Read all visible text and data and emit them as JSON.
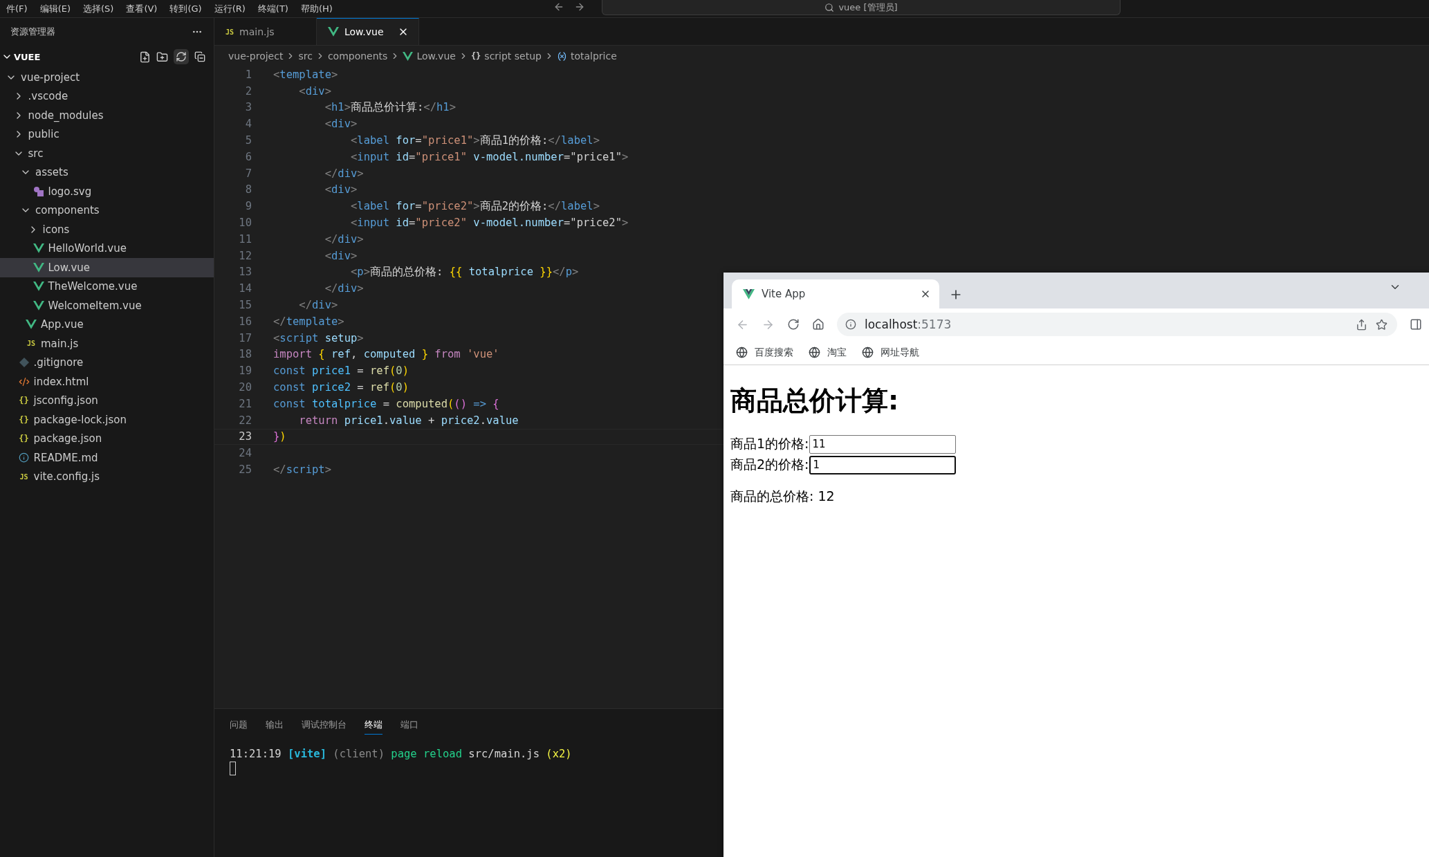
{
  "menu": [
    "件(F)",
    "编辑(E)",
    "选择(S)",
    "查看(V)",
    "转到(G)",
    "运行(R)",
    "终端(T)",
    "帮助(H)"
  ],
  "command_center": {
    "text": "vuee [管理员]"
  },
  "explorer": {
    "title": "资源管理器",
    "section": {
      "title": "VUEE",
      "expanded": true
    },
    "tree": [
      {
        "name": "vue-project",
        "kind": "folder",
        "expanded": true,
        "selected": false,
        "children": [
          {
            "name": ".vscode",
            "kind": "folder",
            "expanded": false,
            "selected": false
          },
          {
            "name": "node_modules",
            "kind": "folder",
            "expanded": false,
            "selected": false
          },
          {
            "name": "public",
            "kind": "folder",
            "expanded": false,
            "selected": false
          },
          {
            "name": "src",
            "kind": "folder",
            "expanded": true,
            "selected": false,
            "children": [
              {
                "name": "assets",
                "kind": "folder",
                "expanded": true,
                "selected": false,
                "children": [
                  {
                    "name": "logo.svg",
                    "kind": "svg",
                    "selected": false
                  }
                ]
              },
              {
                "name": "components",
                "kind": "folder",
                "expanded": true,
                "selected": false,
                "children": [
                  {
                    "name": "icons",
                    "kind": "folder",
                    "expanded": false,
                    "selected": false
                  },
                  {
                    "name": "HelloWorld.vue",
                    "kind": "vue",
                    "selected": false
                  },
                  {
                    "name": "Low.vue",
                    "kind": "vue",
                    "selected": true
                  },
                  {
                    "name": "TheWelcome.vue",
                    "kind": "vue",
                    "selected": false
                  },
                  {
                    "name": "WelcomeItem.vue",
                    "kind": "vue",
                    "selected": false
                  }
                ]
              },
              {
                "name": "App.vue",
                "kind": "vue",
                "selected": false
              },
              {
                "name": "main.js",
                "kind": "js",
                "badge": "JS",
                "selected": false
              }
            ]
          },
          {
            "name": ".gitignore",
            "kind": "git",
            "selected": false
          },
          {
            "name": "index.html",
            "kind": "html",
            "selected": false
          },
          {
            "name": "jsconfig.json",
            "kind": "json",
            "badge": "{}",
            "selected": false
          },
          {
            "name": "package-lock.json",
            "kind": "json",
            "badge": "{}",
            "selected": false
          },
          {
            "name": "package.json",
            "kind": "json",
            "badge": "{}",
            "selected": false
          },
          {
            "name": "README.md",
            "kind": "info",
            "selected": false
          },
          {
            "name": "vite.config.js",
            "kind": "js",
            "badge": "JS",
            "selected": false
          }
        ]
      }
    ]
  },
  "editor_tabs": [
    {
      "label": "main.js",
      "kind": "js",
      "badge": "JS",
      "selected": false
    },
    {
      "label": "Low.vue",
      "kind": "vue",
      "selected": true
    }
  ],
  "breadcrumb": [
    {
      "label": "vue-project",
      "kind": "folder"
    },
    {
      "label": "src",
      "kind": "folder"
    },
    {
      "label": "components",
      "kind": "folder"
    },
    {
      "label": "Low.vue",
      "kind": "vue"
    },
    {
      "label": "script setup",
      "kind": "braces",
      "badge": "{}"
    },
    {
      "label": "totalprice",
      "kind": "variable"
    }
  ],
  "code": [
    {
      "number": "1",
      "current": false,
      "tokens": [
        {
          "kind": "p",
          "text": "<"
        },
        {
          "kind": "tag",
          "text": "template"
        },
        {
          "kind": "p",
          "text": ">"
        }
      ]
    },
    {
      "number": "2",
      "current": false,
      "tokens": [
        {
          "kind": "p",
          "text": "    <"
        },
        {
          "kind": "tag",
          "text": "div"
        },
        {
          "kind": "p",
          "text": ">"
        }
      ]
    },
    {
      "number": "3",
      "current": false,
      "tokens": [
        {
          "kind": "p",
          "text": "        <"
        },
        {
          "kind": "tag",
          "text": "h1"
        },
        {
          "kind": "p",
          "text": ">"
        },
        {
          "kind": "t",
          "text": "商品总价计算:"
        },
        {
          "kind": "p",
          "text": "</"
        },
        {
          "kind": "tag",
          "text": "h1"
        },
        {
          "kind": "p",
          "text": ">"
        }
      ]
    },
    {
      "number": "4",
      "current": false,
      "tokens": [
        {
          "kind": "p",
          "text": "        <"
        },
        {
          "kind": "tag",
          "text": "div"
        },
        {
          "kind": "p",
          "text": ">"
        }
      ]
    },
    {
      "number": "5",
      "current": false,
      "tokens": [
        {
          "kind": "p",
          "text": "            <"
        },
        {
          "kind": "tag",
          "text": "label"
        },
        {
          "kind": "attr",
          "text": " for"
        },
        {
          "kind": "t",
          "text": "="
        },
        {
          "kind": "s",
          "text": "\"price1\""
        },
        {
          "kind": "p",
          "text": ">"
        },
        {
          "kind": "t",
          "text": "商品1的价格:"
        },
        {
          "kind": "p",
          "text": "</"
        },
        {
          "kind": "tag",
          "text": "label"
        },
        {
          "kind": "p",
          "text": ">"
        }
      ]
    },
    {
      "number": "6",
      "current": false,
      "tokens": [
        {
          "kind": "p",
          "text": "            <"
        },
        {
          "kind": "tag",
          "text": "input"
        },
        {
          "kind": "attr",
          "text": " id"
        },
        {
          "kind": "t",
          "text": "="
        },
        {
          "kind": "s",
          "text": "\"price1\""
        },
        {
          "kind": "attr",
          "text": " v-model.number"
        },
        {
          "kind": "t",
          "text": "=\"price1\""
        },
        {
          "kind": "p",
          "text": ">"
        }
      ]
    },
    {
      "number": "7",
      "current": false,
      "tokens": [
        {
          "kind": "p",
          "text": "        </"
        },
        {
          "kind": "tag",
          "text": "div"
        },
        {
          "kind": "p",
          "text": ">"
        }
      ]
    },
    {
      "number": "8",
      "current": false,
      "tokens": [
        {
          "kind": "p",
          "text": "        <"
        },
        {
          "kind": "tag",
          "text": "div"
        },
        {
          "kind": "p",
          "text": ">"
        }
      ]
    },
    {
      "number": "9",
      "current": false,
      "tokens": [
        {
          "kind": "p",
          "text": "            <"
        },
        {
          "kind": "tag",
          "text": "label"
        },
        {
          "kind": "attr",
          "text": " for"
        },
        {
          "kind": "t",
          "text": "="
        },
        {
          "kind": "s",
          "text": "\"price2\""
        },
        {
          "kind": "p",
          "text": ">"
        },
        {
          "kind": "t",
          "text": "商品2的价格:"
        },
        {
          "kind": "p",
          "text": "</"
        },
        {
          "kind": "tag",
          "text": "label"
        },
        {
          "kind": "p",
          "text": ">"
        }
      ]
    },
    {
      "number": "10",
      "current": false,
      "tokens": [
        {
          "kind": "p",
          "text": "            <"
        },
        {
          "kind": "tag",
          "text": "input"
        },
        {
          "kind": "attr",
          "text": " id"
        },
        {
          "kind": "t",
          "text": "="
        },
        {
          "kind": "s",
          "text": "\"price2\""
        },
        {
          "kind": "attr",
          "text": " v-model.number"
        },
        {
          "kind": "t",
          "text": "=\"price2\""
        },
        {
          "kind": "p",
          "text": ">"
        }
      ]
    },
    {
      "number": "11",
      "current": false,
      "tokens": [
        {
          "kind": "p",
          "text": "        </"
        },
        {
          "kind": "tag",
          "text": "div"
        },
        {
          "kind": "p",
          "text": ">"
        }
      ]
    },
    {
      "number": "12",
      "current": false,
      "tokens": [
        {
          "kind": "p",
          "text": "        <"
        },
        {
          "kind": "tag",
          "text": "div"
        },
        {
          "kind": "p",
          "text": ">"
        }
      ]
    },
    {
      "number": "13",
      "current": false,
      "tokens": [
        {
          "kind": "p",
          "text": "            <"
        },
        {
          "kind": "tag",
          "text": "p"
        },
        {
          "kind": "p",
          "text": ">"
        },
        {
          "kind": "t",
          "text": "商品的总价格: "
        },
        {
          "kind": "b1",
          "text": "{{"
        },
        {
          "kind": "attr",
          "text": " totalprice"
        },
        {
          "kind": "b1",
          "text": " }}"
        },
        {
          "kind": "p",
          "text": "</"
        },
        {
          "kind": "tag",
          "text": "p"
        },
        {
          "kind": "p",
          "text": ">"
        }
      ]
    },
    {
      "number": "14",
      "current": false,
      "tokens": [
        {
          "kind": "p",
          "text": "        </"
        },
        {
          "kind": "tag",
          "text": "div"
        },
        {
          "kind": "p",
          "text": ">"
        }
      ]
    },
    {
      "number": "15",
      "current": false,
      "tokens": [
        {
          "kind": "p",
          "text": "    </"
        },
        {
          "kind": "tag",
          "text": "div"
        },
        {
          "kind": "p",
          "text": ">"
        }
      ]
    },
    {
      "number": "16",
      "current": false,
      "tokens": [
        {
          "kind": "p",
          "text": "</"
        },
        {
          "kind": "tag",
          "text": "template"
        },
        {
          "kind": "p",
          "text": ">"
        }
      ]
    },
    {
      "number": "17",
      "current": false,
      "tokens": [
        {
          "kind": "p",
          "text": "<"
        },
        {
          "kind": "tag",
          "text": "script"
        },
        {
          "kind": "attr",
          "text": " setup"
        },
        {
          "kind": "p",
          "text": ">"
        }
      ]
    },
    {
      "number": "18",
      "current": false,
      "tokens": [
        {
          "kind": "kw",
          "text": "import"
        },
        {
          "kind": "b1",
          "text": " {"
        },
        {
          "kind": "attr",
          "text": " ref"
        },
        {
          "kind": "t",
          "text": ","
        },
        {
          "kind": "attr",
          "text": " computed"
        },
        {
          "kind": "b1",
          "text": " }"
        },
        {
          "kind": "kw",
          "text": " from"
        },
        {
          "kind": "s",
          "text": " 'vue'"
        }
      ]
    },
    {
      "number": "19",
      "current": false,
      "tokens": [
        {
          "kind": "decl",
          "text": "const"
        },
        {
          "kind": "v",
          "text": " price1"
        },
        {
          "kind": "t",
          "text": " ="
        },
        {
          "kind": "fn",
          "text": " ref"
        },
        {
          "kind": "b1",
          "text": "("
        },
        {
          "kind": "n",
          "text": "0"
        },
        {
          "kind": "b1",
          "text": ")"
        }
      ]
    },
    {
      "number": "20",
      "current": false,
      "tokens": [
        {
          "kind": "decl",
          "text": "const"
        },
        {
          "kind": "v",
          "text": " price2"
        },
        {
          "kind": "t",
          "text": " ="
        },
        {
          "kind": "fn",
          "text": " ref"
        },
        {
          "kind": "b1",
          "text": "("
        },
        {
          "kind": "n",
          "text": "0"
        },
        {
          "kind": "b1",
          "text": ")"
        }
      ]
    },
    {
      "number": "21",
      "current": false,
      "tokens": [
        {
          "kind": "decl",
          "text": "const"
        },
        {
          "kind": "v",
          "text": " totalprice"
        },
        {
          "kind": "t",
          "text": " ="
        },
        {
          "kind": "fn",
          "text": " computed"
        },
        {
          "kind": "b1",
          "text": "("
        },
        {
          "kind": "b2",
          "text": "()"
        },
        {
          "kind": "decl",
          "text": " =>"
        },
        {
          "kind": "b2",
          "text": " {"
        }
      ]
    },
    {
      "number": "22",
      "current": false,
      "tokens": [
        {
          "kind": "kw",
          "text": "    return"
        },
        {
          "kind": "attr",
          "text": " price1"
        },
        {
          "kind": "t",
          "text": "."
        },
        {
          "kind": "attr",
          "text": "value"
        },
        {
          "kind": "t",
          "text": " +"
        },
        {
          "kind": "attr",
          "text": " price2"
        },
        {
          "kind": "t",
          "text": "."
        },
        {
          "kind": "attr",
          "text": "value"
        }
      ]
    },
    {
      "number": "23",
      "current": true,
      "tokens": [
        {
          "kind": "b2",
          "text": "}"
        },
        {
          "kind": "b1",
          "text": ")"
        }
      ]
    },
    {
      "number": "24",
      "current": false
    },
    {
      "number": "25",
      "current": false,
      "tokens": [
        {
          "kind": "p",
          "text": "</"
        },
        {
          "kind": "tag",
          "text": "script"
        },
        {
          "kind": "p",
          "text": ">"
        }
      ]
    }
  ],
  "panel": {
    "tabs": [
      {
        "label": "问题",
        "selected": false
      },
      {
        "label": "输出",
        "selected": false
      },
      {
        "label": "调试控制台",
        "selected": false
      },
      {
        "label": "终端",
        "selected": true
      },
      {
        "label": "端口",
        "selected": false
      }
    ],
    "terminal": [
      {
        "kind": "t",
        "text": "11:21:19 "
      },
      {
        "kind": "cyan",
        "text": "[vite]"
      },
      {
        "kind": "grey",
        "text": " (client)"
      },
      {
        "kind": "green",
        "text": " page reload"
      },
      {
        "kind": "t",
        "text": " src/main.js"
      },
      {
        "kind": "yellow",
        "text": " (x2)"
      }
    ]
  },
  "browser": {
    "tab": {
      "title": "Vite App",
      "selected": true
    },
    "address": {
      "host": "localhost",
      "port": ":5173"
    },
    "bookmarks": [
      "百度搜索",
      "淘宝",
      "网址导航"
    ],
    "page": {
      "heading": "商品总价计算:",
      "fields": [
        {
          "label": "商品1的价格:",
          "value": "11",
          "focused": false
        },
        {
          "label": "商品2的价格:",
          "value": "1",
          "focused": true
        }
      ],
      "total": "商品的总价格: 12"
    }
  }
}
